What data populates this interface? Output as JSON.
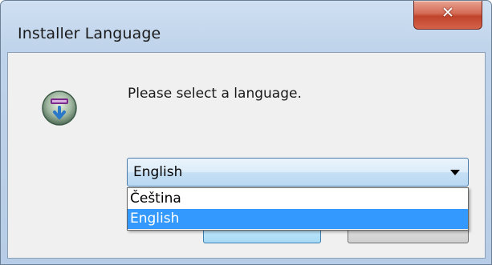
{
  "window": {
    "title": "Installer Language",
    "close_icon": "close-icon"
  },
  "dialog": {
    "prompt": "Please select a language.",
    "app_icon": "installer-icon"
  },
  "language_select": {
    "selected": "English",
    "options": [
      {
        "label": "Čeština",
        "selected": false
      },
      {
        "label": "English",
        "selected": true
      }
    ]
  },
  "colors": {
    "selection_highlight": "#3399ff",
    "close_button": "#c0432b"
  }
}
